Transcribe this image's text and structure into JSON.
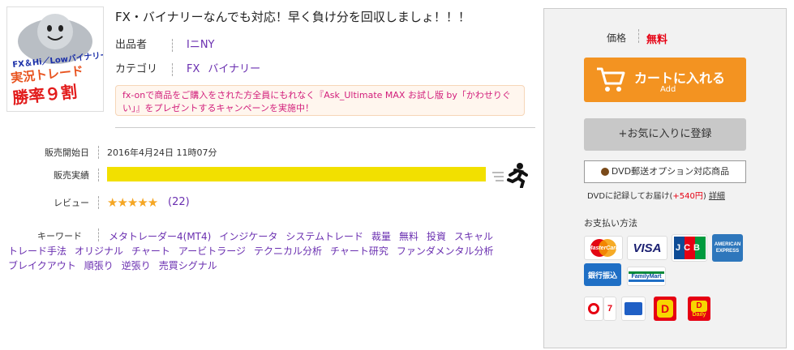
{
  "product": {
    "title": "FX・バイナリーなんでも対応！早く負け分を回収しましょ！！！",
    "publisher_label": "出品者",
    "publisher": "IニNY",
    "category_label": "カテゴリ",
    "categories": [
      "FX",
      "バイナリー"
    ],
    "thumb_text": [
      "FX＆Hi／Lowバイナリー",
      "実況トレード",
      "勝率９割"
    ],
    "promo": "fx-onで商品をご購入をされた方全員にもれなく『Ask_Ultimate MAX お試し版 by「かわせりぐい」』をプレゼントするキャンペーンを実施中！"
  },
  "details": {
    "release_label": "販売開始日",
    "release_value": "2016年4月24日 11時07分",
    "sales_label": "販売実績",
    "sales_level": 1.0,
    "review_label": "レビュー",
    "review_stars": "★★★★★",
    "review_rating": 4.5,
    "review_count": "(22)",
    "keyword_label": "キーワード",
    "keywords": [
      "メタトレーダー4(MT4)",
      "インジケータ",
      "システムトレード",
      "裁量",
      "無料",
      "投資",
      "スキャル",
      "トレード手法",
      "オリジナル",
      "チャート",
      "アービトラージ",
      "テクニカル分析",
      "チャート研究",
      "ファンダメンタル分析",
      "ブレイクアウト",
      "順張り",
      "逆張り",
      "売買シグナル"
    ]
  },
  "side": {
    "price_label": "価格",
    "price_value": "無料",
    "cart_label": "カートに入れる",
    "cart_sub": "Add",
    "fav_label": "+お気に入りに登録",
    "dvd_label": "DVD郵送オプション対応商品",
    "dvd_note_prefix": "DVDに記録してお届け(",
    "dvd_note_price": "+540円",
    "dvd_note_suffix": ")",
    "dvd_detail": "詳細",
    "payment_label": "お支払い方法",
    "cards": {
      "mastercard": "MasterCard",
      "visa": "VISA",
      "jcb": "JCB",
      "amex": "AMERICAN EXPRESS",
      "bank": "銀行振込",
      "familymart": "FamilyMart",
      "daily": "Daily"
    },
    "colors": {
      "cart": "#f39321",
      "price": "#e60012",
      "bar": "#f2e000"
    }
  }
}
